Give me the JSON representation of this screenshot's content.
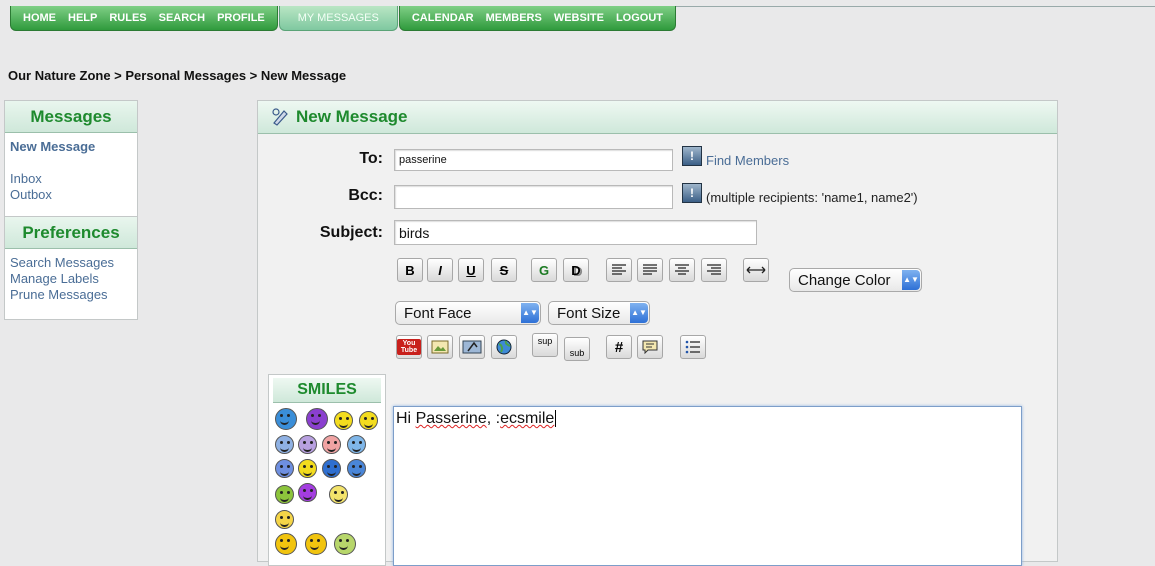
{
  "nav": {
    "left_items": [
      "HOME",
      "HELP",
      "RULES",
      "SEARCH",
      "PROFILE"
    ],
    "active_item": "MY MESSAGES",
    "right_items": [
      "CALENDAR",
      "MEMBERS",
      "WEBSITE",
      "LOGOUT"
    ]
  },
  "breadcrumb": {
    "text": "Our Nature Zone > Personal Messages > New Message"
  },
  "sidebar": {
    "messages_title": "Messages",
    "new_message": "New Message",
    "inbox": "Inbox",
    "outbox": "Outbox",
    "preferences_title": "Preferences",
    "search_messages": "Search Messages",
    "manage_labels": "Manage Labels",
    "prune_messages": "Prune Messages"
  },
  "form": {
    "title": "New Message",
    "to_label": "To:",
    "to_value": "passerine",
    "find_members": "Find Members",
    "bcc_label": "Bcc:",
    "bcc_value": "",
    "bcc_note": "(multiple recipients: 'name1, name2')",
    "subject_label": "Subject:",
    "subject_value": "birds",
    "help_glyph": "!",
    "change_color": "Change Color",
    "font_face": "Font Face",
    "font_size": "Font Size",
    "sup": "sup",
    "sub": "sub",
    "hash": "#",
    "bold": "B",
    "italic": "I",
    "underline": "U",
    "strike": "S",
    "glow": "G",
    "shadow": "D",
    "select_arrows": "▲▼",
    "youtube": "You Tube"
  },
  "smiles": {
    "title": "SMILES",
    "colors": [
      "#3a8ed8",
      "#8a3fcf",
      "#f3dc1e",
      "#f3dc1e",
      "#8fb1e3",
      "#b8a0e0",
      "#f0a3a3",
      "#7fb6e8",
      "#6e8fe0",
      "#f3dc1e",
      "#2f6fd0",
      "#4a86d8",
      "#8cc43c",
      "#a33de0",
      "#f3e36b",
      "#f5d548",
      "#f1c40f",
      "#f1c40f",
      "#b7d66b"
    ]
  },
  "editor": {
    "text_plain": "Hi ",
    "text_word": "Passerine",
    "text_mid": ",  :",
    "text_code": "ecsmile"
  }
}
